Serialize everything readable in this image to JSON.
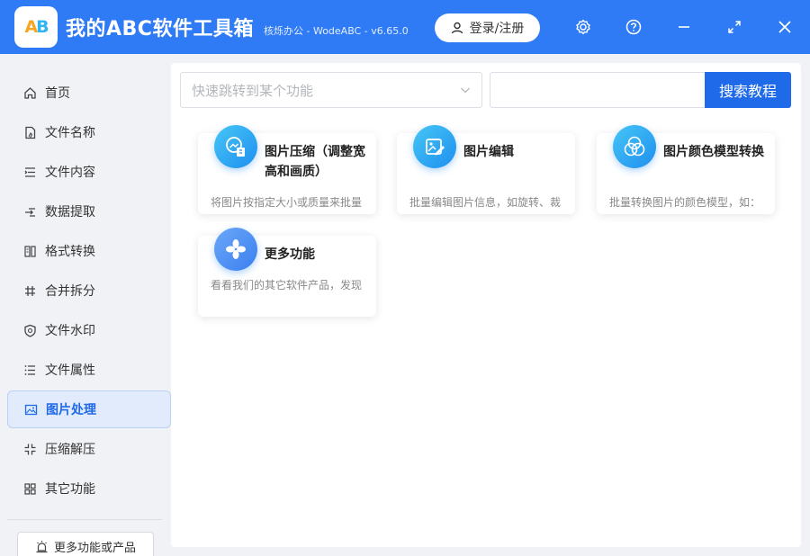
{
  "app": {
    "title": "我的ABC软件工具箱",
    "subtitle": "核烁办公 - WodeABC - v6.65.0",
    "logo_text": "AB"
  },
  "header": {
    "login_label": "登录/注册",
    "icons": [
      "settings-icon",
      "help-icon",
      "maximize-icon",
      "close-icon"
    ]
  },
  "sidebar": {
    "items": [
      {
        "label": "首页",
        "icon": "home-icon"
      },
      {
        "label": "文件名称",
        "icon": "file-name-icon"
      },
      {
        "label": "文件内容",
        "icon": "file-content-icon"
      },
      {
        "label": "数据提取",
        "icon": "data-extract-icon"
      },
      {
        "label": "格式转换",
        "icon": "format-convert-icon"
      },
      {
        "label": "合并拆分",
        "icon": "merge-split-icon"
      },
      {
        "label": "文件水印",
        "icon": "watermark-icon"
      },
      {
        "label": "文件属性",
        "icon": "file-attribute-icon"
      },
      {
        "label": "图片处理",
        "icon": "image-icon",
        "active": true
      },
      {
        "label": "压缩解压",
        "icon": "compress-icon"
      },
      {
        "label": "其它功能",
        "icon": "other-icon"
      }
    ],
    "more_label": "更多功能或产品"
  },
  "search": {
    "quick_placeholder": "快速跳转到某个功能",
    "input_value": "",
    "button_label": "搜索教程"
  },
  "cards": [
    {
      "title": "图片压缩（调整宽高和画质）",
      "desc": "将图片按指定大小或质量来批量",
      "icon": "image-compress-icon"
    },
    {
      "title": "图片编辑",
      "desc": "批量编辑图片信息，如旋转、裁",
      "icon": "image-edit-icon"
    },
    {
      "title": "图片颜色模型转换",
      "desc": "批量转换图片的颜色模型，如：",
      "icon": "color-model-icon"
    },
    {
      "title": "更多功能",
      "desc": "看看我们的其它软件产品，发现",
      "icon": "more-features-icon"
    }
  ],
  "colors": {
    "accent": "#1f6ae8",
    "titlebar": "#2f7bf5",
    "sidebar_active_bg": "#e1ebfb"
  }
}
